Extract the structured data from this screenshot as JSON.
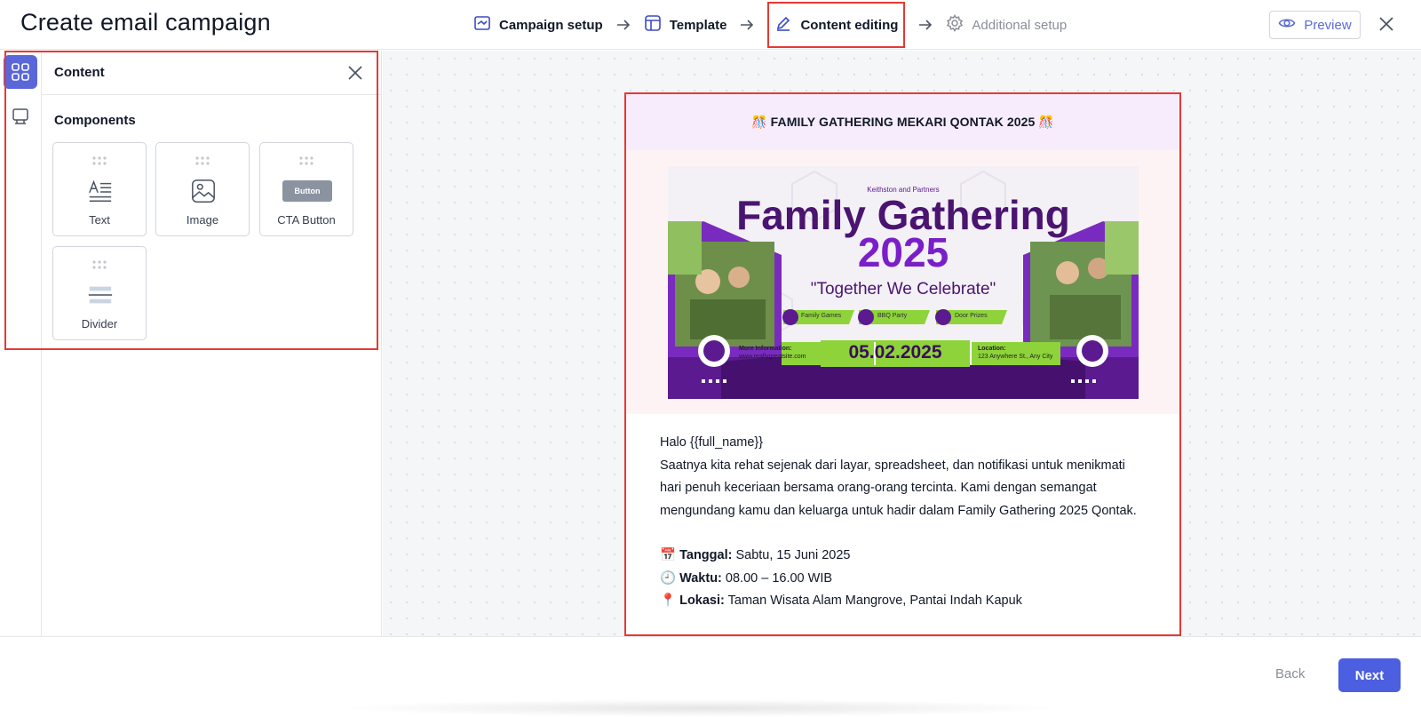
{
  "header": {
    "title": "Create email campaign",
    "steps": [
      {
        "label": "Campaign setup"
      },
      {
        "label": "Template"
      },
      {
        "label": "Content editing"
      },
      {
        "label": "Additional setup"
      }
    ],
    "preview_label": "Preview"
  },
  "panel": {
    "title": "Content",
    "components_label": "Components",
    "components": [
      {
        "label": "Text",
        "icon": "text-icon"
      },
      {
        "label": "Image",
        "icon": "image-icon"
      },
      {
        "label": "CTA Button",
        "icon": "button-icon",
        "chip": "Button"
      },
      {
        "label": "Divider",
        "icon": "divider-icon"
      }
    ]
  },
  "email": {
    "banner": "🎊 FAMILY GATHERING MEKARI QONTAK 2025 🎊",
    "hero": {
      "org": "Keithston and Partners",
      "title_line1": "Family Gathering",
      "title_line2": "2025",
      "tagline": "\"Together We Celebrate\"",
      "tags": [
        "Family Games",
        "BBQ Party",
        "Door Prizes"
      ],
      "info_label": "More Information:",
      "info_value": "www.reallygreatsite.com",
      "date": "05.02.2025",
      "location_label": "Location:",
      "location_value": "123 Anywhere St., Any City"
    },
    "greeting": "Halo {{full_name}}",
    "paragraph": "Saatnya kita rehat sejenak dari layar, spreadsheet, dan notifikasi untuk menikmati hari penuh keceriaan bersama orang-orang tercinta. Kami dengan semangat mengundang kamu dan keluarga untuk hadir dalam Family Gathering 2025 Qontak.",
    "details": [
      {
        "emoji": "📅",
        "label": "Tanggal:",
        "value": "Sabtu, 15 Juni 2025"
      },
      {
        "emoji": "🕘",
        "label": "Waktu:",
        "value": "08.00 – 16.00 WIB"
      },
      {
        "emoji": "📍",
        "label": "Lokasi:",
        "value": "Taman Wisata Alam Mangrove, Pantai Indah Kapuk"
      }
    ]
  },
  "footer": {
    "back_label": "Back",
    "next_label": "Next"
  },
  "colors": {
    "accent": "#4c5fe0",
    "highlight_border": "#e53935",
    "hero_purple": "#5b1a8f",
    "hero_green": "#8ed33a"
  }
}
